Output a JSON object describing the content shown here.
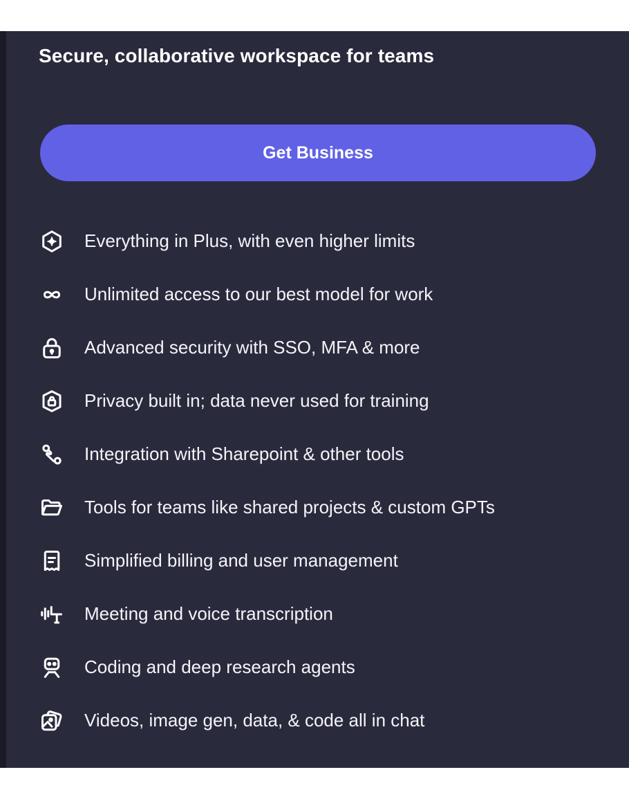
{
  "plan": {
    "tagline": "Secure, collaborative workspace for teams",
    "cta_label": "Get Business",
    "features": [
      {
        "icon": "sparkle-hexagon-icon",
        "text": "Everything in Plus, with even higher limits"
      },
      {
        "icon": "infinity-icon",
        "text": "Unlimited access to our best model for work"
      },
      {
        "icon": "lock-icon",
        "text": "Advanced security with SSO, MFA & more"
      },
      {
        "icon": "shield-lock-icon",
        "text": "Privacy built in; data never used for training"
      },
      {
        "icon": "integration-link-icon",
        "text": "Integration with Sharepoint & other tools"
      },
      {
        "icon": "folder-icon",
        "text": "Tools for teams like shared projects & custom GPTs"
      },
      {
        "icon": "receipt-icon",
        "text": "Simplified billing and user management"
      },
      {
        "icon": "voice-transcription-icon",
        "text": "Meeting and voice transcription"
      },
      {
        "icon": "robot-agent-icon",
        "text": "Coding and deep research agents"
      },
      {
        "icon": "media-gallery-icon",
        "text": "Videos, image gen, data, & code all in chat"
      }
    ]
  },
  "colors": {
    "panel_background": "#2a2a3d",
    "button_background": "#6161e6",
    "text": "#ffffff"
  }
}
